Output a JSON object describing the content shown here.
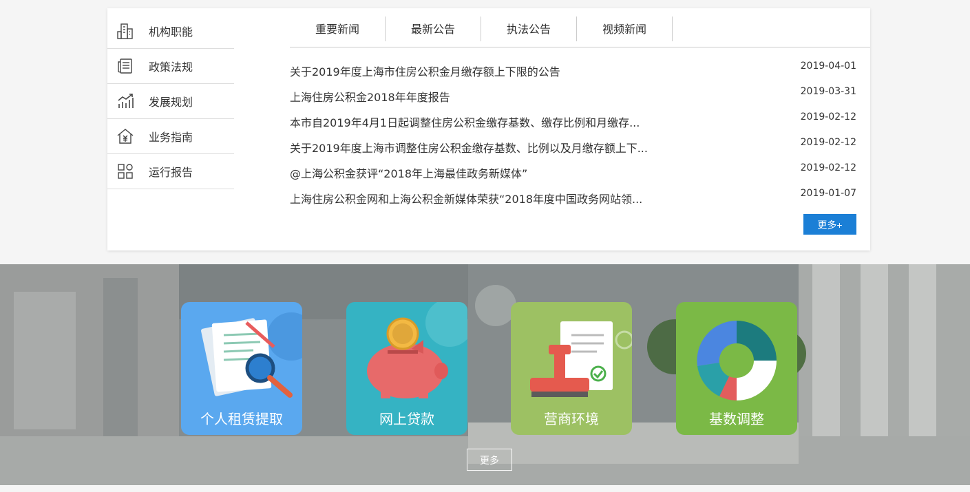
{
  "sidenav": {
    "items": [
      {
        "label": "机构职能",
        "icon": "building-icon"
      },
      {
        "label": "政策法规",
        "icon": "document-list-icon"
      },
      {
        "label": "发展规划",
        "icon": "growth-chart-icon"
      },
      {
        "label": "业务指南",
        "icon": "house-yen-icon"
      },
      {
        "label": "运行报告",
        "icon": "grid-apps-icon"
      }
    ]
  },
  "tabs": [
    "重要新闻",
    "最新公告",
    "执法公告",
    "视频新闻"
  ],
  "news": [
    {
      "title": "关于2019年度上海市住房公积金月缴存额上下限的公告",
      "date": "2019-04-01"
    },
    {
      "title": "上海住房公积金2018年年度报告",
      "date": "2019-03-31"
    },
    {
      "title": "本市自2019年4月1日起调整住房公积金缴存基数、缴存比例和月缴存...",
      "date": "2019-02-12"
    },
    {
      "title": "关于2019年度上海市调整住房公积金缴存基数、比例以及月缴存额上下...",
      "date": "2019-02-12"
    },
    {
      "title": "@上海公积金获评“2018年上海最佳政务新媒体”",
      "date": "2019-02-12"
    },
    {
      "title": "上海住房公积金网和上海公积金新媒体荣获“2018年度中国政务网站领...",
      "date": "2019-01-07"
    }
  ],
  "more_button": "更多+",
  "services": [
    {
      "label": "个人租赁提取",
      "icon": "documents-magnifier-icon",
      "color": "#5aa8ef"
    },
    {
      "label": "网上贷款",
      "icon": "piggy-bank-icon",
      "color": "#35b3c3"
    },
    {
      "label": "营商环境",
      "icon": "stamp-document-icon",
      "color": "#9dc163"
    },
    {
      "label": "基数调整",
      "icon": "donut-chart-icon",
      "color": "#7bb946"
    }
  ],
  "services_more": "更多",
  "colors": {
    "accent": "#1b7fd6"
  }
}
